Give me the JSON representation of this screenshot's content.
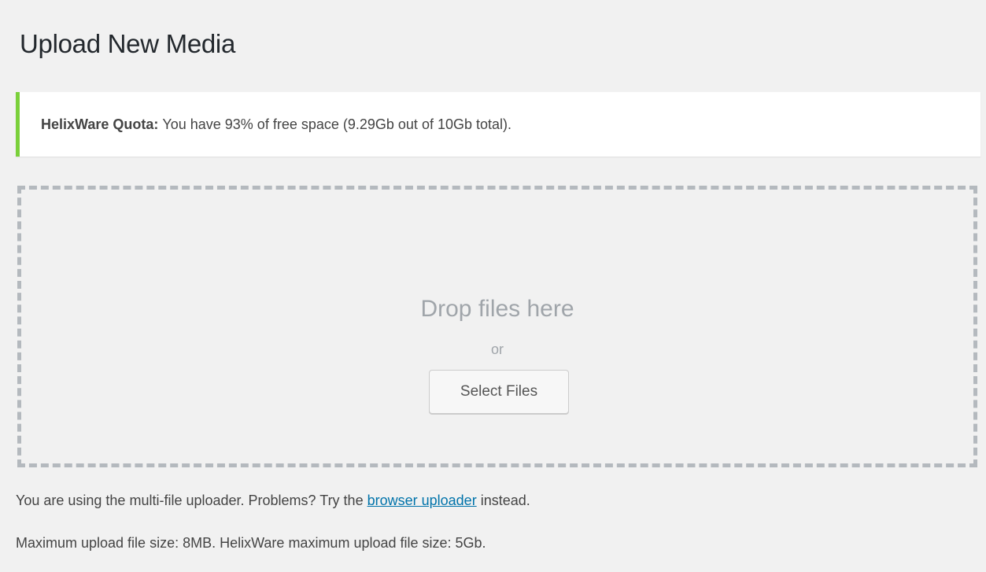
{
  "page": {
    "title": "Upload New Media"
  },
  "notice": {
    "label": "HelixWare Quota:",
    "message": "You have 93% of free space (9.29Gb out of 10Gb total).",
    "free_space_percent": 93,
    "accent_color": "#7ad03a"
  },
  "uploader": {
    "drop_text": "Drop files here",
    "or_text": "or",
    "select_button_label": "Select Files"
  },
  "info": {
    "multi_file_prefix": "You are using the multi-file uploader. Problems? Try the",
    "browser_uploader_link": "browser uploader",
    "multi_file_suffix": "instead.",
    "max_size_text": "Maximum upload file size: 8MB. HelixWare maximum upload file size: 5Gb."
  },
  "colors": {
    "background": "#f1f1f1",
    "link": "#0073aa",
    "dashed_border": "#b4b9be"
  }
}
